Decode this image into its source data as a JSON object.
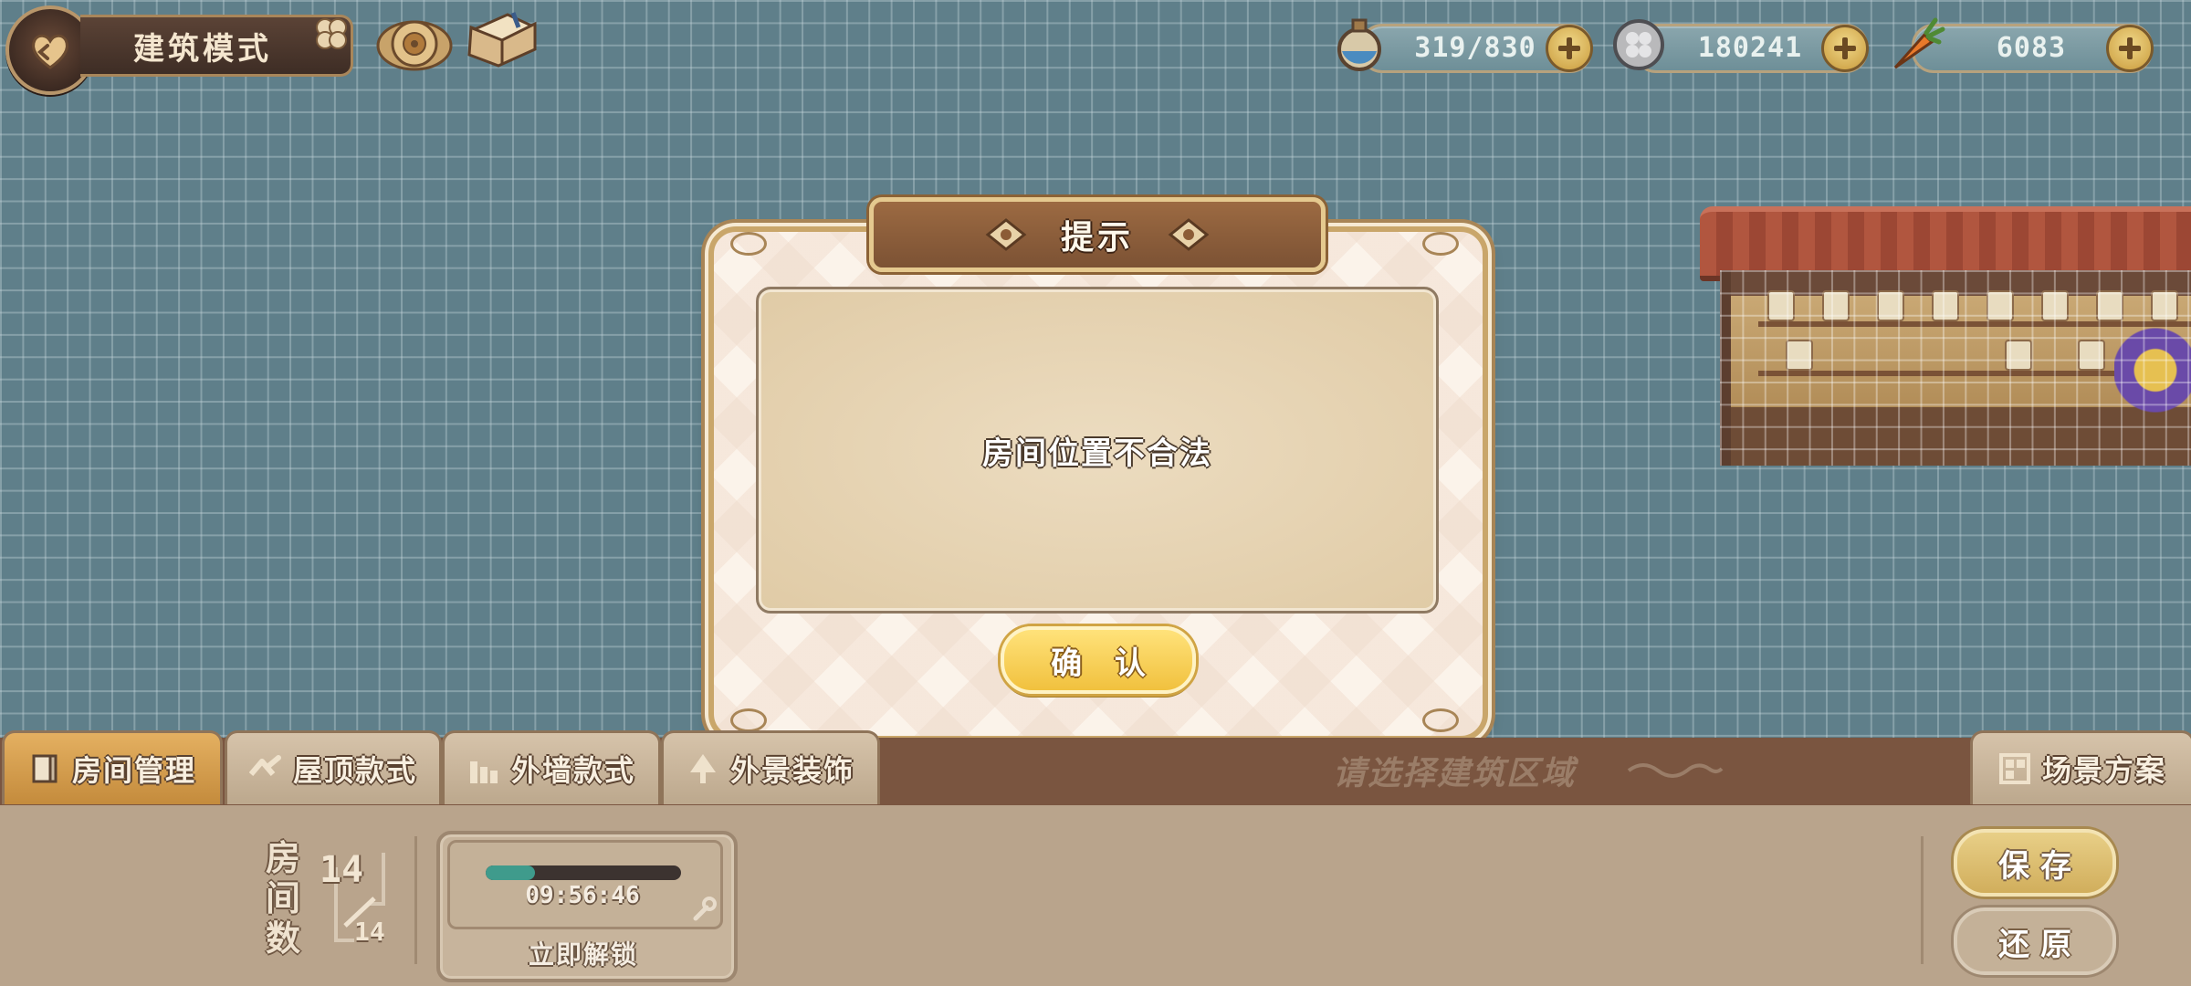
{
  "top_bar": {
    "mode_title": "建筑模式"
  },
  "currencies": [
    {
      "name": "potion",
      "icon": "potion-flask-icon",
      "value": "319/830"
    },
    {
      "name": "clover-coin",
      "icon": "clover-coin-icon",
      "value": "180241"
    },
    {
      "name": "carrot",
      "icon": "carrot-icon",
      "value": "6083"
    }
  ],
  "dialog": {
    "title": "提示",
    "message": "房间位置不合法",
    "confirm_label": "确 认"
  },
  "tabs": [
    {
      "label": "房间管理",
      "icon": "door-icon",
      "active": true
    },
    {
      "label": "屋顶款式",
      "icon": "roof-icon",
      "active": false
    },
    {
      "label": "外墙款式",
      "icon": "wall-icon",
      "active": false
    },
    {
      "label": "外景装饰",
      "icon": "tree-icon",
      "active": false
    }
  ],
  "hint_text": "请选择建筑区域",
  "scene_plan_label": "场景方案",
  "room": {
    "label": "房间数",
    "count": "14",
    "total": "14"
  },
  "unlock": {
    "timer": "09:56:46",
    "progress": 0.25,
    "label": "立即解锁"
  },
  "actions": {
    "save_label": "保存",
    "restore_label": "还原"
  },
  "colors": {
    "background": "#5f7f8a",
    "confirm_button": "#f1c13e",
    "title_bar": "#8b5e3c",
    "progress_fill": "#3f9b8c"
  }
}
